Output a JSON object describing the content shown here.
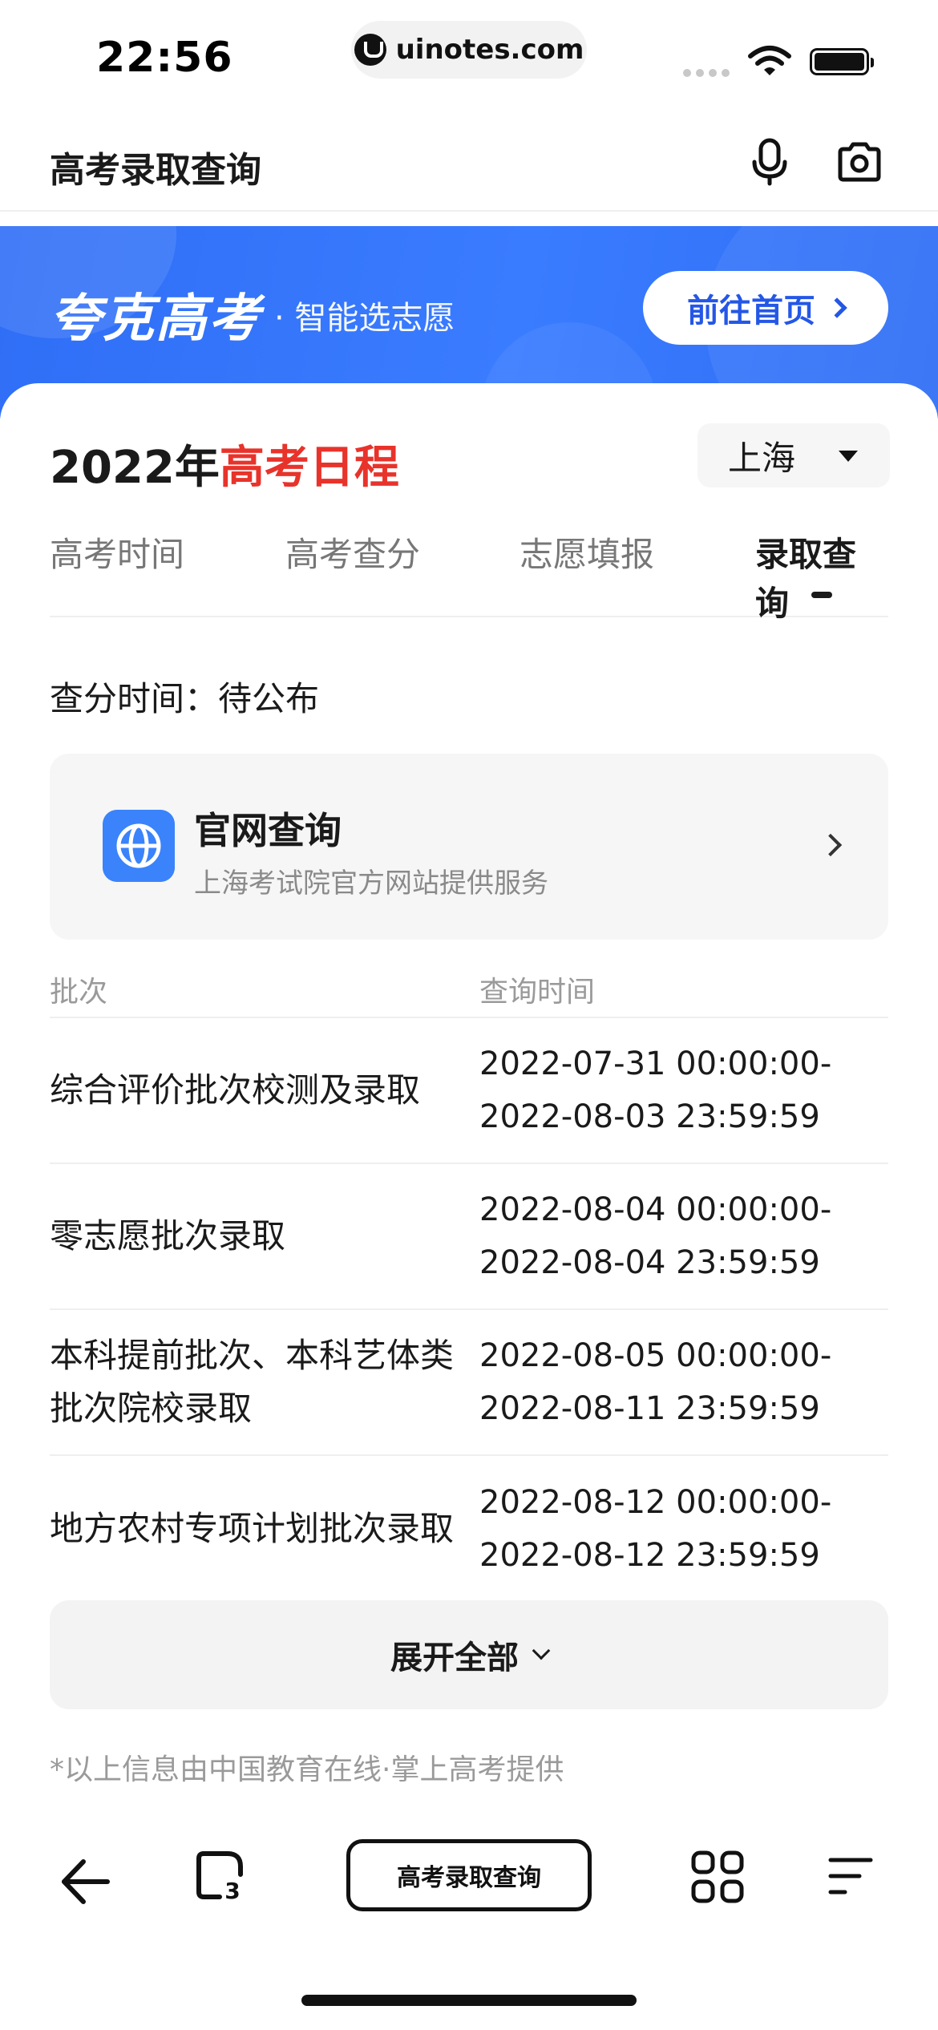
{
  "status_bar": {
    "time": "22:56",
    "url": "uinotes.com"
  },
  "header": {
    "title": "高考录取查询"
  },
  "banner": {
    "title": "夸克高考",
    "subtitle": "· 智能选志愿",
    "home_button": "前往首页"
  },
  "schedule": {
    "year_prefix": "2022年",
    "year_highlight": "高考日程",
    "region": "上海"
  },
  "tabs": [
    {
      "label": "高考时间"
    },
    {
      "label": "高考查分"
    },
    {
      "label": "志愿填报"
    },
    {
      "label": "录取查询"
    }
  ],
  "active_tab": "录取查询",
  "score_time": "查分时间：待公布",
  "official": {
    "title": "官网查询",
    "subtitle": "上海考试院官方网站提供服务"
  },
  "table": {
    "headers": [
      "批次",
      "查询时间"
    ],
    "rows": [
      {
        "name": "综合评价批次校测及录取",
        "time_start": "2022-07-31 00:00:00-",
        "time_end": "2022-08-03 23:59:59"
      },
      {
        "name": "零志愿批次录取",
        "time_start": "2022-08-04 00:00:00-",
        "time_end": "2022-08-04 23:59:59"
      },
      {
        "name": "本科提前批次、本科艺体类批次院校录取",
        "time_start": "2022-08-05 00:00:00-",
        "time_end": "2022-08-11 23:59:59"
      },
      {
        "name": "地方农村专项计划批次录取",
        "time_start": "2022-08-12 00:00:00-",
        "time_end": "2022-08-12 23:59:59"
      }
    ]
  },
  "expand_button": "展开全部",
  "footnote": "*以上信息由中国教育在线·掌上高考提供",
  "toolbar": {
    "center_label": "高考录取查询",
    "tab_count": "3"
  },
  "colors": {
    "accent_blue": "#2f6ef6",
    "highlight_red": "#e8332b"
  }
}
